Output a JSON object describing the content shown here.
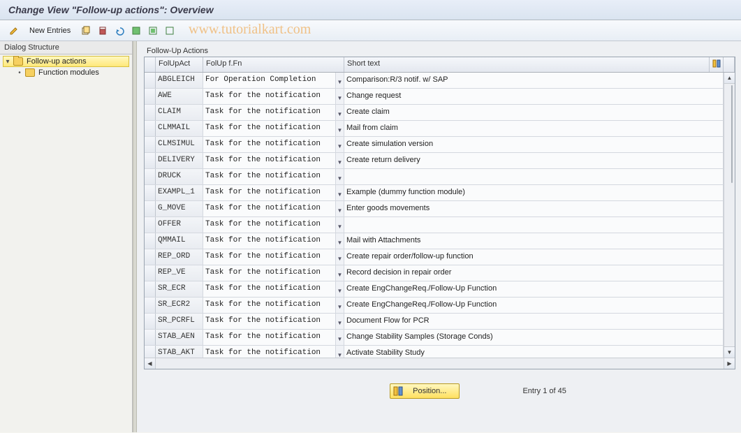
{
  "title": "Change View \"Follow-up actions\": Overview",
  "toolbar": {
    "new_entries": "New Entries"
  },
  "watermark": "www.tutorialkart.com",
  "dialog_structure": {
    "title": "Dialog Structure",
    "items": [
      {
        "label": "Follow-up actions",
        "selected": true,
        "expanded": true
      },
      {
        "label": "Function modules",
        "selected": false,
        "expanded": false
      }
    ]
  },
  "panel": {
    "title": "Follow-Up Actions"
  },
  "columns": {
    "folupact": "FolUpAct",
    "folupffn": "FolUp f.Fn",
    "shorttext": "Short text"
  },
  "rows": [
    {
      "act": "ABGLEICH",
      "fn": "For Operation Completion",
      "txt": "Comparison:R/3 notif. w/ SAP"
    },
    {
      "act": "AWE",
      "fn": "Task for the notification",
      "txt": "Change request"
    },
    {
      "act": "CLAIM",
      "fn": "Task for the notification",
      "txt": "Create claim"
    },
    {
      "act": "CLMMAIL",
      "fn": "Task for the notification",
      "txt": "Mail from claim"
    },
    {
      "act": "CLMSIMUL",
      "fn": "Task for the notification",
      "txt": "Create simulation version"
    },
    {
      "act": "DELIVERY",
      "fn": "Task for the notification",
      "txt": "Create return delivery"
    },
    {
      "act": "DRUCK",
      "fn": "Task for the notification",
      "txt": ""
    },
    {
      "act": "EXAMPL_1",
      "fn": "Task for the notification",
      "txt": "Example (dummy function module)"
    },
    {
      "act": "G_MOVE",
      "fn": "Task for the notification",
      "txt": "Enter goods movements"
    },
    {
      "act": "OFFER",
      "fn": "Task for the notification",
      "txt": ""
    },
    {
      "act": "QMMAIL",
      "fn": "Task for the notification",
      "txt": "Mail with Attachments"
    },
    {
      "act": "REP_ORD",
      "fn": "Task for the notification",
      "txt": "Create repair order/follow-up function"
    },
    {
      "act": "REP_VE",
      "fn": "Task for the notification",
      "txt": "Record decision in repair order"
    },
    {
      "act": "SR_ECR",
      "fn": "Task for the notification",
      "txt": "Create EngChangeReq./Follow-Up Function"
    },
    {
      "act": "SR_ECR2",
      "fn": "Task for the notification",
      "txt": "Create EngChangeReq./Follow-Up Function"
    },
    {
      "act": "SR_PCRFL",
      "fn": "Task for the notification",
      "txt": "Document Flow for PCR"
    },
    {
      "act": "STAB_AEN",
      "fn": "Task for the notification",
      "txt": "Change Stability Samples (Storage Conds)"
    },
    {
      "act": "STAB_AKT",
      "fn": "Task for the notification",
      "txt": "Activate Stability Study"
    }
  ],
  "footer": {
    "position": "Position...",
    "entry": "Entry 1 of 45"
  }
}
